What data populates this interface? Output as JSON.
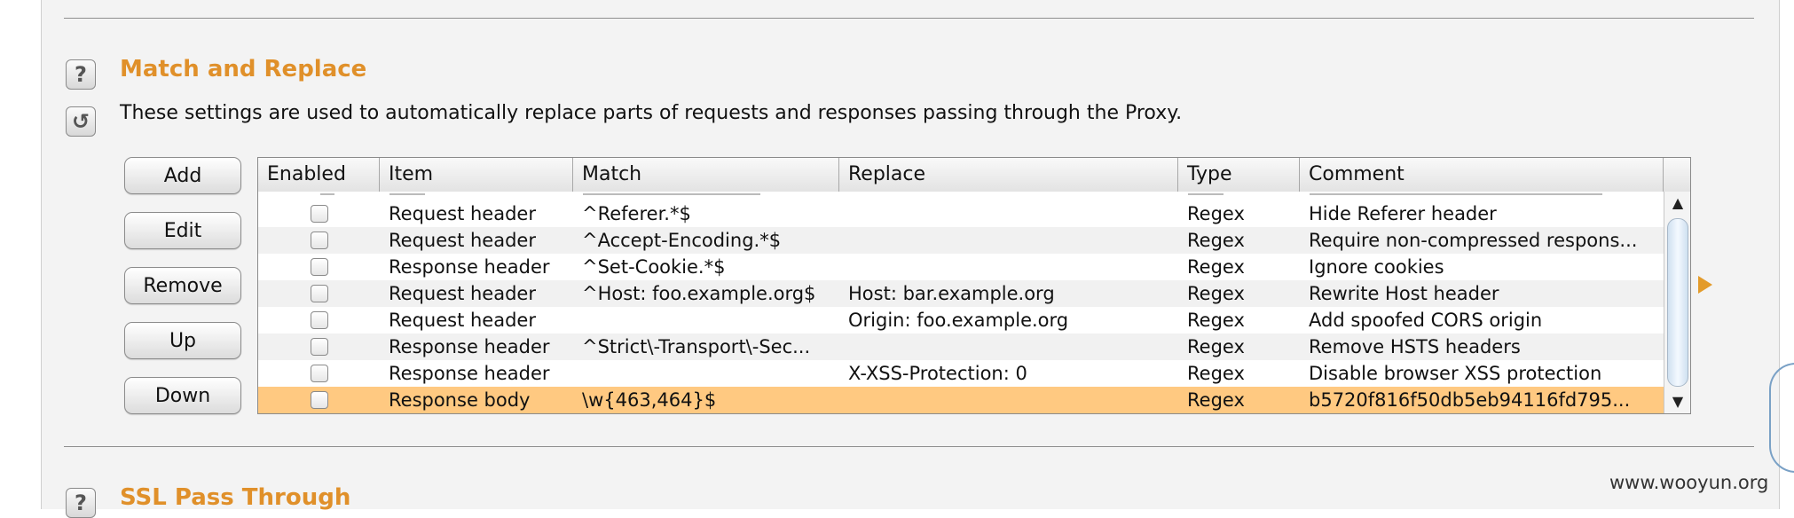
{
  "section": {
    "title": "Match and Replace",
    "description": "These settings are used to automatically replace parts of requests and responses passing through the Proxy."
  },
  "next_section": {
    "title": "SSL Pass Through"
  },
  "help_icons": {
    "help": "?",
    "restore": "↺"
  },
  "buttons": {
    "add": "Add",
    "edit": "Edit",
    "remove": "Remove",
    "up": "Up",
    "down": "Down"
  },
  "table": {
    "columns": [
      "Enabled",
      "Item",
      "Match",
      "Replace",
      "Type",
      "Comment"
    ],
    "rows": [
      {
        "enabled": false,
        "item": "Request header",
        "match": "^Referer.*$",
        "replace": "",
        "type": "Regex",
        "comment": "Hide Referer header",
        "selected": false
      },
      {
        "enabled": false,
        "item": "Request header",
        "match": "^Accept-Encoding.*$",
        "replace": "",
        "type": "Regex",
        "comment": "Require non-compressed respons...",
        "selected": false
      },
      {
        "enabled": false,
        "item": "Response header",
        "match": "^Set-Cookie.*$",
        "replace": "",
        "type": "Regex",
        "comment": "Ignore cookies",
        "selected": false
      },
      {
        "enabled": false,
        "item": "Request header",
        "match": "^Host: foo.example.org$",
        "replace": "Host: bar.example.org",
        "type": "Regex",
        "comment": "Rewrite Host header",
        "selected": false
      },
      {
        "enabled": false,
        "item": "Request header",
        "match": "",
        "replace": "Origin: foo.example.org",
        "type": "Regex",
        "comment": "Add spoofed CORS origin",
        "selected": false
      },
      {
        "enabled": false,
        "item": "Response header",
        "match": "^Strict\\-Transport\\-Sec...",
        "replace": "",
        "type": "Regex",
        "comment": "Remove HSTS headers",
        "selected": false
      },
      {
        "enabled": false,
        "item": "Response header",
        "match": "",
        "replace": "X-XSS-Protection: 0",
        "type": "Regex",
        "comment": "Disable browser XSS protection",
        "selected": false
      },
      {
        "enabled": false,
        "item": "Response body",
        "match": "\\w{463,464}$",
        "replace": "",
        "type": "Regex",
        "comment": " b5720f816f50db5eb94116fd795...",
        "selected": true
      }
    ]
  },
  "scrollbar": {
    "up_arrow": "▲",
    "down_arrow": "▼"
  },
  "watermark": "www.wooyun.org",
  "colors": {
    "section_title": "#e0902a",
    "selected_row": "#ffc981"
  }
}
